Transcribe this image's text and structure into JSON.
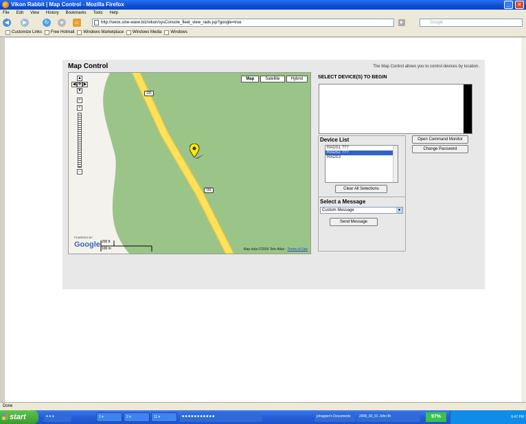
{
  "window": {
    "title": "Vikon Rabbit | Map Control - Mozilla Firefox"
  },
  "menu": [
    "File",
    "Edit",
    "View",
    "History",
    "Bookmarks",
    "Tools",
    "Help"
  ],
  "nav": {
    "url": "http://swox.sine-wave.biz/vikon/sysConsole_fleet_view_rads.jsp?google=true",
    "search_placeholder": "Google"
  },
  "bookmarks": [
    "Customize Links",
    "Free Hotmail",
    "Windows Marketplace",
    "Windows Media",
    "Windows"
  ],
  "page": {
    "title": "Map Control",
    "description": "The Map Control allows you to control devices by location.",
    "map": {
      "types": [
        "Map",
        "Satellite",
        "Hybrid"
      ],
      "active_type": "Map",
      "route_shield": "191",
      "powered_by": "POWERED BY",
      "google_logo": "Google",
      "scale_ft": "200 ft",
      "scale_m": "100 m",
      "attribution": "Map data ©2006 Tele Atlas - ",
      "terms": "Terms of Use"
    },
    "select_heading": "SELECT DEVICE(S) TO BEGIN",
    "device_list": {
      "heading": "Device List",
      "items": [
        "RADS1 ???",
        "RADS2 ???",
        "RADS3"
      ],
      "selected_index": 1,
      "clear_button": "Clear All Selections"
    },
    "message": {
      "heading": "Select a Message",
      "selected": "Custom Message",
      "send_button": "Send Message"
    },
    "buttons": {
      "monitor": "Open Command Monitor",
      "password": "Change Password"
    }
  },
  "status": "Done",
  "taskbar": {
    "start": "start",
    "items": [
      "2 ▾",
      "2 ▾",
      "11 ▾",
      "johupper's Documents",
      "2008_03_01 John Br"
    ],
    "battery": "97%",
    "clock": "6:47 PM"
  }
}
